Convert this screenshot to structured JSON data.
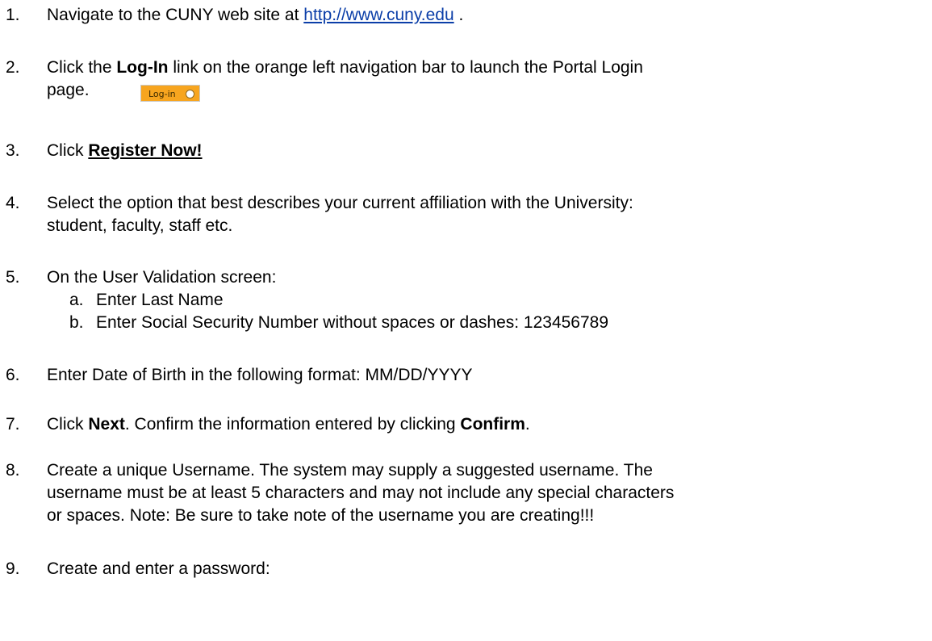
{
  "steps": [
    {
      "num": "1.",
      "pre": "Navigate to the CUNY web site at ",
      "link": "http://www.cuny.edu",
      "post": " ."
    },
    {
      "num": "2.",
      "pre": "Click the ",
      "bold": "Log-In",
      "post": " link on the orange left navigation bar to launch the Portal Login",
      "line2": "page.",
      "button_label": "Log-in"
    },
    {
      "num": "3.",
      "pre": "Click ",
      "bold": "Register Now!"
    },
    {
      "num": "4.",
      "line1": "Select the option that best describes your current affiliation with the University:",
      "line2": "student, faculty, staff etc."
    },
    {
      "num": "5.",
      "text": "On the User Validation screen:",
      "subs": [
        {
          "letter": "a.",
          "text": "Enter Last Name"
        },
        {
          "letter": "b.",
          "text": "Enter Social Security Number without spaces or dashes: 123456789"
        }
      ]
    },
    {
      "num": "6.",
      "text": "Enter Date of Birth in the following format: MM/DD/YYYY"
    },
    {
      "num": "7.",
      "pre": "Click ",
      "bold1": "Next",
      "mid": ". Confirm the information entered by clicking ",
      "bold2": "Confirm",
      "post": "."
    },
    {
      "num": "8.",
      "line1": "Create a unique Username.  The system may supply a suggested username.  The",
      "line2": "username must be at least 5 characters and may not include any special characters",
      "line3": "or spaces.  Note: Be sure to take note of the username you are creating!!!"
    },
    {
      "num": "9.",
      "text": "Create and enter a password:"
    }
  ],
  "colors": {
    "link": "#0b3ea8",
    "login_button": "#f7a51f"
  }
}
